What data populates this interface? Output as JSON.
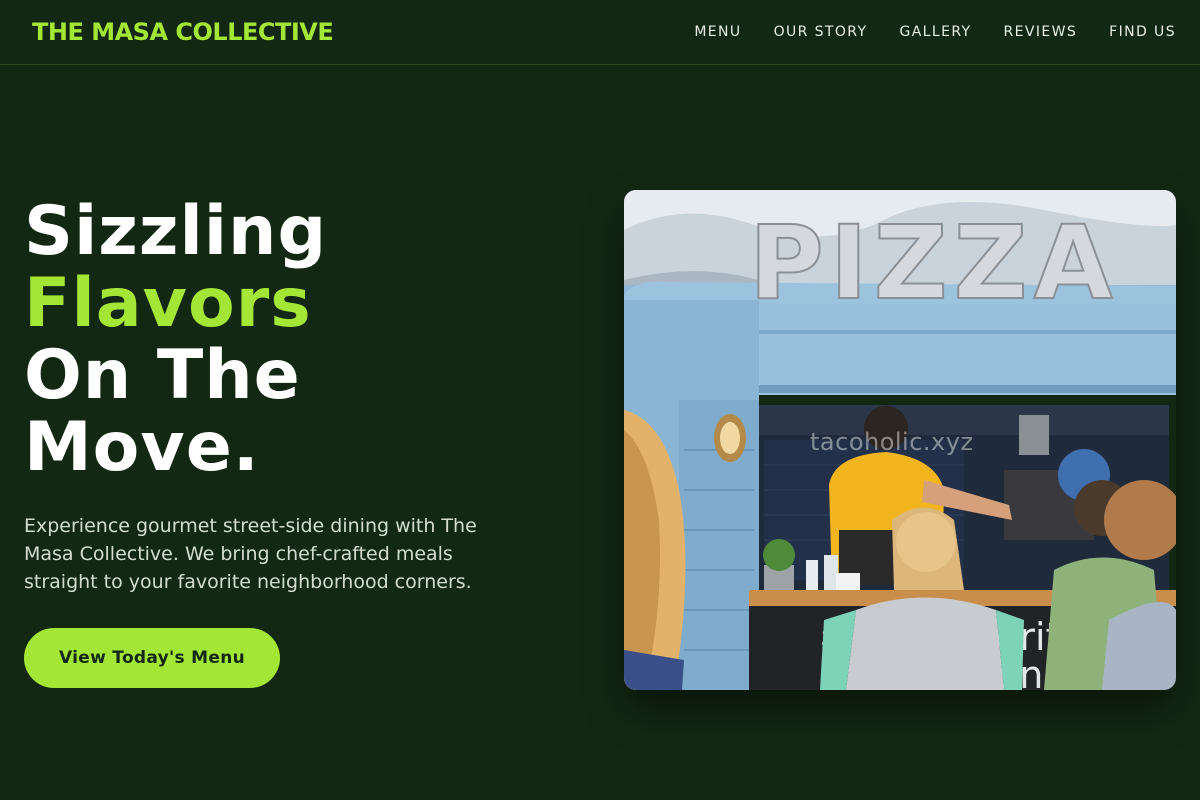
{
  "header": {
    "brand": "THE MASA COLLECTIVE",
    "nav": [
      "MENU",
      "OUR STORY",
      "GALLERY",
      "REVIEWS",
      "FIND US"
    ]
  },
  "hero": {
    "headline": [
      "Sizzling",
      "Flavors",
      "On The",
      "Move."
    ],
    "subtext": "Experience gourmet street-side dining with The Masa Collective. We bring chef-crafted meals straight to your favorite neighborhood corners.",
    "cta_label": "View Today's Menu"
  },
  "photo": {
    "sign_text": "PIZZA",
    "watermark": "tacoholic.xyz",
    "chalkboard_text": [
      "£",
      "erit",
      "oni"
    ]
  },
  "colors": {
    "background": "#132813",
    "accent": "#a3e635"
  }
}
